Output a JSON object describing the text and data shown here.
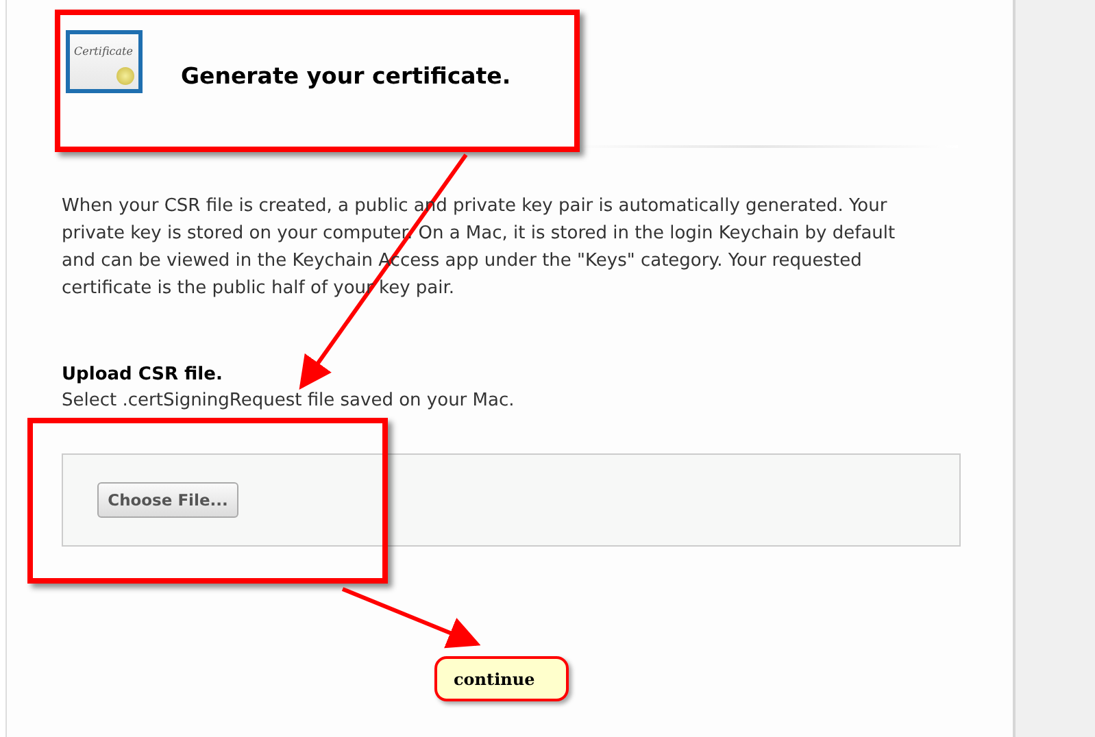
{
  "header": {
    "icon_label": "Certificate",
    "title": "Generate your certificate."
  },
  "intro": "When your CSR file is created, a public and private key pair is automatically generated. Your private key is stored on your computer. On a Mac, it is stored in the login Keychain by default and can be viewed in the Keychain Access app under the \"Keys\" category. Your requested certificate is the public half of your key pair.",
  "upload": {
    "heading": "Upload CSR file.",
    "hint": "Select .certSigningRequest file saved on your Mac.",
    "button": "Choose File..."
  },
  "annotation": {
    "callout": "continue"
  }
}
